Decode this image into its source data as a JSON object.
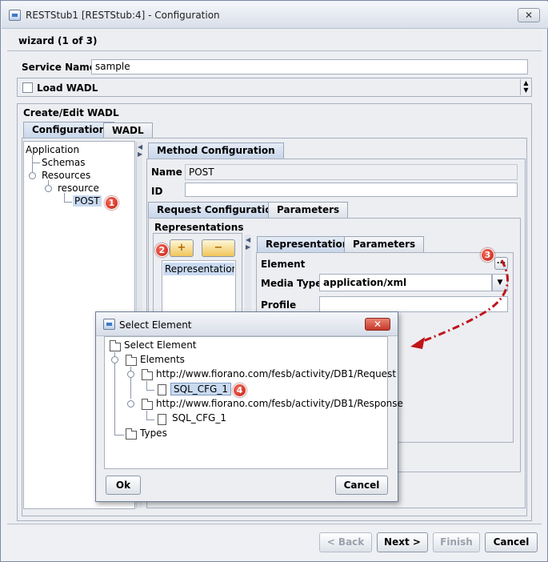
{
  "window": {
    "title": "RESTStub1 [RESTStub:4] - Configuration",
    "close_symbol": "✕"
  },
  "wizard": {
    "step_label": "wizard (1 of 3)"
  },
  "service": {
    "label": "Service Name",
    "value": "sample"
  },
  "load_wadl": {
    "label": "Load WADL",
    "checked": false
  },
  "create_edit": {
    "group_label": "Create/Edit WADL",
    "tabs": [
      "Configuration",
      "WADL"
    ],
    "active_tab": "Configuration"
  },
  "tree": {
    "root": "Application",
    "children": [
      "Schemas",
      "Resources"
    ],
    "resource": "resource",
    "method": "POST"
  },
  "method_config": {
    "tab_label": "Method Configuration",
    "name_label": "Name",
    "name_value": "POST",
    "id_label": "ID",
    "id_value": ""
  },
  "request_tabs": [
    "Request Configuration",
    "Parameters"
  ],
  "representations": {
    "label": "Representations",
    "add_symbol": "+",
    "remove_symbol": "−",
    "list_item": "Representation..."
  },
  "representation_tabs": [
    "Representation",
    "Parameters"
  ],
  "representation": {
    "element_label": "Element",
    "element_button": "...",
    "media_type_label": "Media Type",
    "media_type_value": "application/xml",
    "profile_label": "Profile",
    "profile_value": ""
  },
  "badges": [
    "1",
    "2",
    "3",
    "4"
  ],
  "select_dialog": {
    "title": "Select Element",
    "close_symbol": "✕",
    "root": "Select Element",
    "elements": "Elements",
    "request_ns": "http://www.fiorano.com/fesb/activity/DB1/Request",
    "request_item": "SQL_CFG_1",
    "response_ns": "http://www.fiorano.com/fesb/activity/DB1/Response",
    "response_item": "SQL_CFG_1",
    "types": "Types",
    "ok_label": "Ok",
    "cancel_label": "Cancel"
  },
  "footer": {
    "back_label": "< Back",
    "next_label": "Next >",
    "finish_label": "Finish",
    "cancel_label": "Cancel"
  },
  "colors": {
    "badge_red": "#d42a1d",
    "selection": "#c9daf1",
    "arrow": "#c0141a"
  }
}
